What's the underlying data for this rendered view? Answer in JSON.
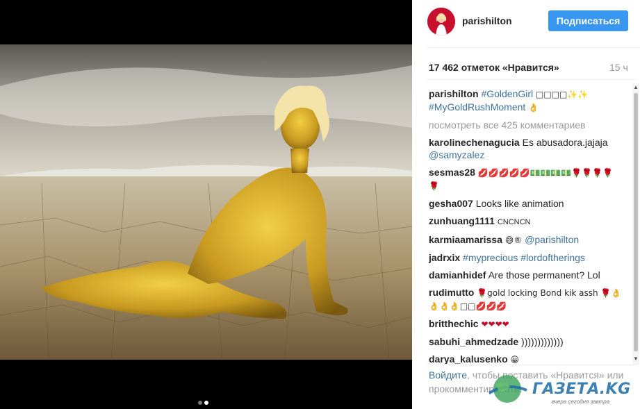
{
  "post": {
    "carousel": {
      "total_slides": 2,
      "active_slide": 2
    }
  },
  "header": {
    "username": "parishilton",
    "follow_label": "Подписаться"
  },
  "stats": {
    "likes": "17 462 отметок «Нравится»",
    "time_ago": "15 ч"
  },
  "caption": {
    "user": "parishilton",
    "hashtag1": "#GoldenGirl",
    "emojis": "□□□□✨✨",
    "hashtag2": "#MyGoldRushMoment",
    "emoji2": "👌"
  },
  "view_all": "посмотреть все 425 комментариев",
  "comments": [
    {
      "user": "karolinechenagucia",
      "text": "Es abusadora.jajaja",
      "mention": "@samyzalez"
    },
    {
      "user": "sesmas28",
      "text": "💋💋💋💋💋💵💵💵💵🌹🌹🌹🌹🌹"
    },
    {
      "user": "gesha007",
      "text": "Looks like animation"
    },
    {
      "user": "zunhuang1111",
      "text": "CNCNCN"
    },
    {
      "user": "karmiaamarissa",
      "text": "😅®",
      "mention": "@parishilton"
    },
    {
      "user": "jadrxix",
      "hashtags": "#myprecious #lordoftherings"
    },
    {
      "user": "damianhidef",
      "text": "Are those permanent? Lol"
    },
    {
      "user": "rudimutto",
      "text": "🌹gold locking Bond kik assh 🌹👌👌👌👌□□💋💋💋"
    },
    {
      "user": "britthechic",
      "text": "❤❤❤❤"
    },
    {
      "user": "sabuhi_ahmedzade",
      "text": ")))))))))))))"
    },
    {
      "user": "darya_kalusenko",
      "text": "😀"
    }
  ],
  "login_prompt": {
    "link": "Войдите",
    "rest": ", чтобы поставить «Нравится» или прокомментировать."
  },
  "watermark": {
    "text": "ГАЗЕТА.KG",
    "subtitle": "вчера сегодня завтра"
  },
  "colors": {
    "follow_button": "#3897f0",
    "hashtag": "#3f729b",
    "muted": "#999999"
  }
}
